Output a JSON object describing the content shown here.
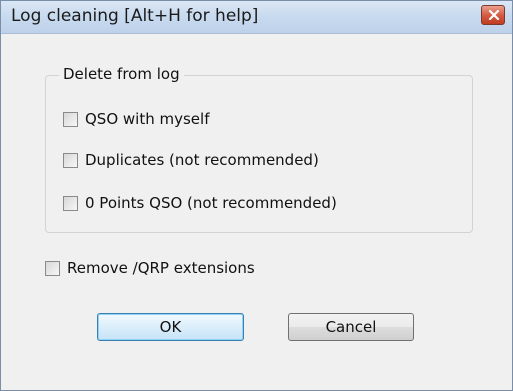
{
  "dialog": {
    "title": "Log cleaning [Alt+H for help]",
    "close_icon": "close-icon"
  },
  "group": {
    "legend": "Delete from log",
    "options": [
      {
        "label": "QSO with myself",
        "checked": false
      },
      {
        "label": "Duplicates (not recommended)",
        "checked": false
      },
      {
        "label": "0 Points QSO (not recommended)",
        "checked": false
      }
    ]
  },
  "extra_option": {
    "label": "Remove /QRP extensions",
    "checked": false
  },
  "buttons": {
    "ok_label": "OK",
    "cancel_label": "Cancel"
  },
  "colors": {
    "titlebar": "#c9dbef",
    "close_button": "#c23b22",
    "dialog_background": "#f0f0f0",
    "default_button_border": "#3c7fb1"
  }
}
